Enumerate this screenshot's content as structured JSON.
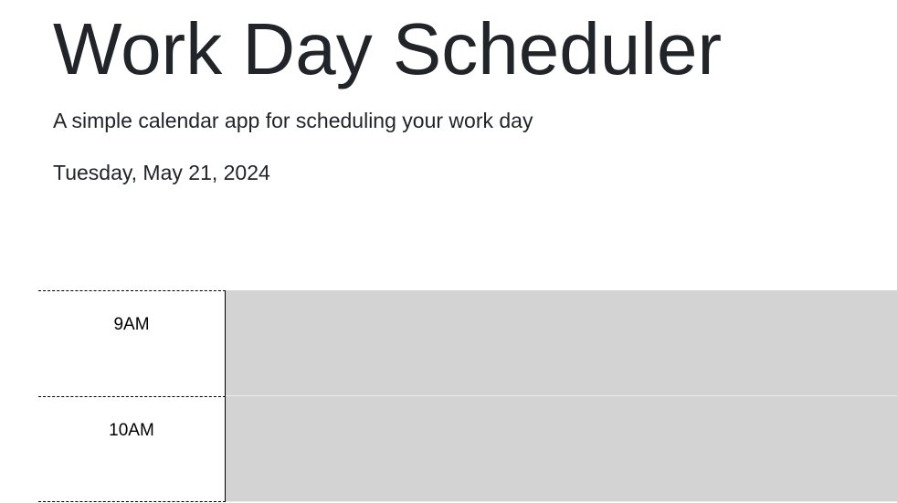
{
  "header": {
    "title": "Work Day Scheduler",
    "subtitle": "A simple calendar app for scheduling your work day",
    "current_day": "Tuesday, May 21, 2024"
  },
  "schedule": {
    "blocks": [
      {
        "hour": "9AM",
        "description": "",
        "state": "past"
      },
      {
        "hour": "10AM",
        "description": "",
        "state": "past"
      }
    ]
  },
  "colors": {
    "past": "#d3d3d3",
    "text": "#212529"
  }
}
